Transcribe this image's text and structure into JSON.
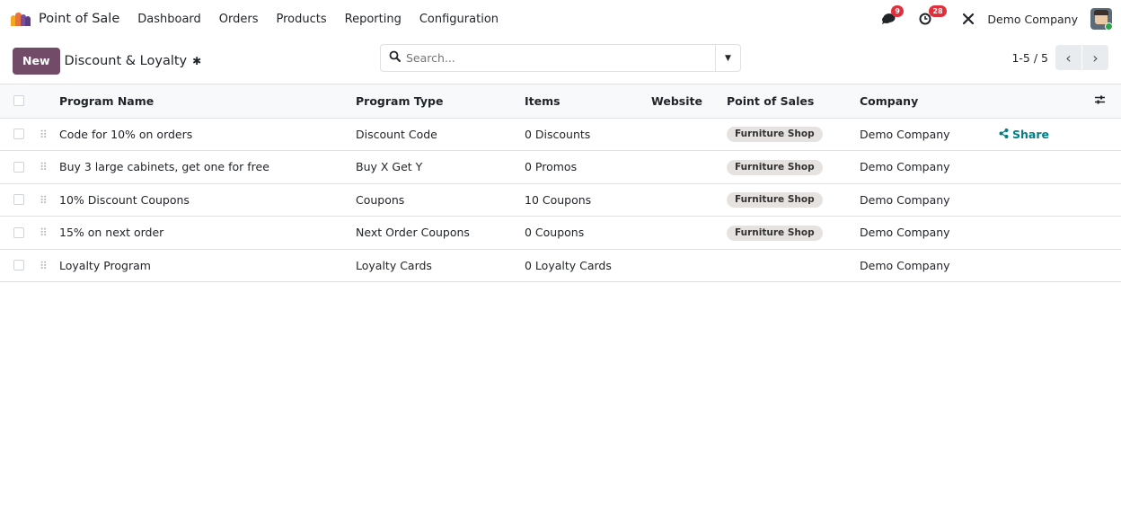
{
  "navbar": {
    "app_name": "Point of Sale",
    "menu": [
      "Dashboard",
      "Orders",
      "Products",
      "Reporting",
      "Configuration"
    ],
    "messages_badge": "9",
    "activities_badge": "28",
    "company": "Demo Company"
  },
  "control_panel": {
    "new_label": "New",
    "title": "Discount & Loyalty",
    "search_placeholder": "Search...",
    "pager": "1-5 / 5"
  },
  "table": {
    "headers": [
      "Program Name",
      "Program Type",
      "Items",
      "Website",
      "Point of Sales",
      "Company"
    ],
    "rows": [
      {
        "name": "Code for 10% on orders",
        "type": "Discount Code",
        "items": "0 Discounts",
        "website": "",
        "pos": "Furniture Shop",
        "company": "Demo Company",
        "action": "Share"
      },
      {
        "name": "Buy 3 large cabinets, get one for free",
        "type": "Buy X Get Y",
        "items": "0 Promos",
        "website": "",
        "pos": "Furniture Shop",
        "company": "Demo Company",
        "action": ""
      },
      {
        "name": "10% Discount Coupons",
        "type": "Coupons",
        "items": "10 Coupons",
        "website": "",
        "pos": "Furniture Shop",
        "company": "Demo Company",
        "action": ""
      },
      {
        "name": "15% on next order",
        "type": "Next Order Coupons",
        "items": "0 Coupons",
        "website": "",
        "pos": "Furniture Shop",
        "company": "Demo Company",
        "action": ""
      },
      {
        "name": "Loyalty Program",
        "type": "Loyalty Cards",
        "items": "0 Loyalty Cards",
        "website": "",
        "pos": "",
        "company": "Demo Company",
        "action": ""
      }
    ]
  },
  "colors": {
    "brand": "#714b67",
    "share_link": "#017e84",
    "badge": "#e02f3b",
    "tag_bg": "#e6e2e0"
  },
  "icons": {
    "logo": "pos-logo-icon",
    "settings": "gear-icon",
    "search": "search-icon",
    "messages": "chat-icon",
    "activities": "clock-icon",
    "tools": "tools-icon",
    "optional_columns": "sliders-icon",
    "share": "share-icon",
    "drag": "drag-handle-icon"
  }
}
